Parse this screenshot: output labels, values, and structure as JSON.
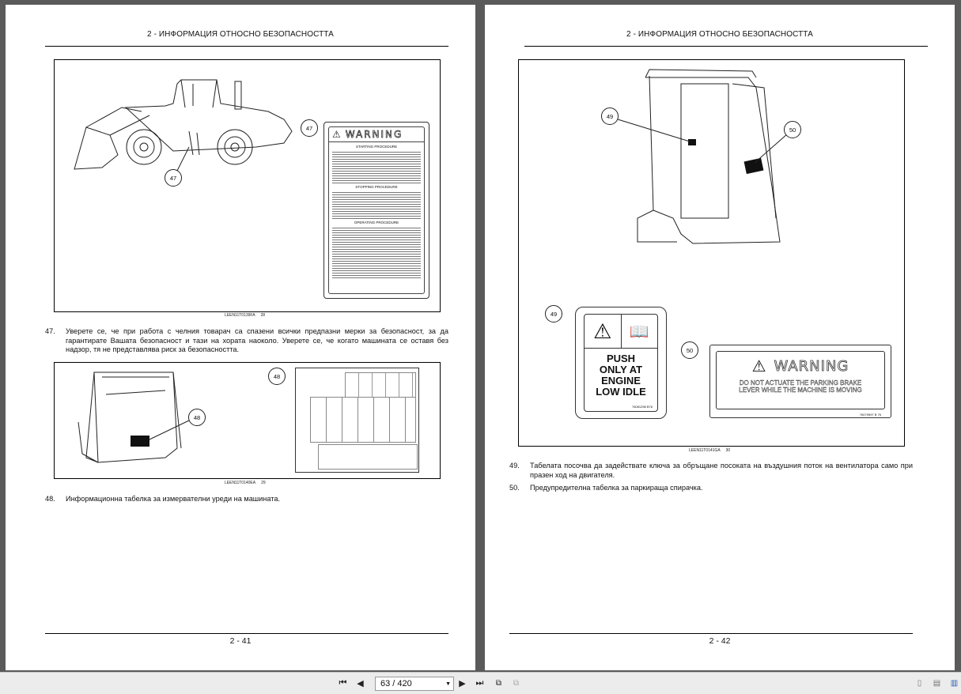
{
  "header": "2 - ИНФОРМАЦИЯ ОТНОСНО БЕЗОПАСНОСТТА",
  "page_left": {
    "footer": "2 - 41",
    "fig1": {
      "caption": "LEEN11T0139FA",
      "number": "28",
      "callouts": [
        "47",
        "47"
      ],
      "decal": {
        "title": "WARNING",
        "sections": [
          "STARTING PROCEDURE",
          "STOPPING PROCEDURE",
          "OPERATING PROCEDURE"
        ]
      }
    },
    "item47": {
      "num": "47.",
      "text": "Уверете се, че при работа с челния товарач са спазени всички предпазни мерки за безопасност, за да гарантирате Вашата безопасност и тази на хората наоколо. Уверете се, че когато машината се оставя без надзор, тя не представлява риск за безопасността."
    },
    "fig2": {
      "caption": "LEEN11T0140EA",
      "number": "29",
      "callouts": [
        "48",
        "48"
      ]
    },
    "item48": {
      "num": "48.",
      "text": "Информационна табелка за измервателни уреди на машината."
    }
  },
  "page_right": {
    "footer": "2 - 42",
    "fig3": {
      "caption": "LEEN11T0141GA",
      "number": "30",
      "callouts": [
        "49",
        "50",
        "49",
        "50"
      ],
      "decal49": {
        "lines": [
          "PUSH",
          "ONLY AT",
          "ENGINE",
          "LOW IDLE"
        ],
        "code": "76081298 B76"
      },
      "decal50": {
        "title": "WARNING",
        "line1": "DO NOT ACTUATE THE PARKING BRAKE",
        "line2": "LEVER WHILE THE MACHINE IS MOVING",
        "code": "76079597 B 76"
      }
    },
    "item49": {
      "num": "49.",
      "text": "Табелата посочва да задействате ключа за обръщане посоката на въздушния поток на вентилатора само при празен ход на двигателя."
    },
    "item50": {
      "num": "50.",
      "text": "Предупредителна табелка за паркираща спирачка."
    }
  },
  "toolbar": {
    "page_value": "63 / 420"
  }
}
